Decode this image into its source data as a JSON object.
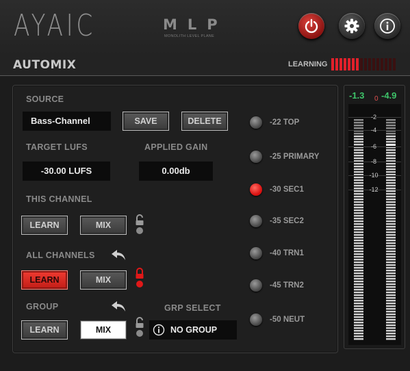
{
  "header": {
    "logo": "AYAIC",
    "product": "MLP",
    "product_sub": "MONOLITH LEVEL PLANE",
    "buttons": [
      "power-icon",
      "gear-icon",
      "info-icon"
    ],
    "colors": {
      "power": "#d8403a",
      "accent_red": "#e0202a",
      "meter_green": "#3ec46a"
    }
  },
  "title": "AUTOMIX",
  "learning": {
    "label": "LEARNING",
    "segments_total": 16,
    "segments_on": 7
  },
  "source": {
    "label": "SOURCE",
    "value": "Bass-Channel",
    "save_label": "SAVE",
    "delete_label": "DELETE"
  },
  "target": {
    "label": "TARGET LUFS",
    "value": "-30.00 LUFS"
  },
  "gain": {
    "label": "APPLIED GAIN",
    "value": "0.00db"
  },
  "this_channel": {
    "label": "THIS CHANNEL",
    "learn_label": "LEARN",
    "mix_label": "MIX",
    "learn_active": false,
    "locked": false
  },
  "all_channels": {
    "label": "ALL CHANNELS",
    "learn_label": "LEARN",
    "mix_label": "MIX",
    "learn_active": true,
    "locked": true
  },
  "group": {
    "label": "GROUP",
    "learn_label": "LEARN",
    "mix_label": "MIX",
    "mix_active": true,
    "locked": false
  },
  "grp_select": {
    "label": "GRP SELECT",
    "value": "NO GROUP"
  },
  "targets": [
    {
      "label": "-22 TOP",
      "selected": false
    },
    {
      "label": "-25 PRIMARY",
      "selected": false
    },
    {
      "label": "-30 SEC1",
      "selected": true
    },
    {
      "label": "-35 SEC2",
      "selected": false
    },
    {
      "label": "-40 TRN1",
      "selected": false
    },
    {
      "label": "-45 TRN2",
      "selected": false
    },
    {
      "label": "-50 NEUT",
      "selected": false
    }
  ],
  "meter": {
    "left_value": "-1.3",
    "zero_label": "0",
    "right_value": "-4.9",
    "scale": [
      "-2",
      "-4",
      "-6",
      "-8",
      "-10",
      "-12"
    ]
  }
}
